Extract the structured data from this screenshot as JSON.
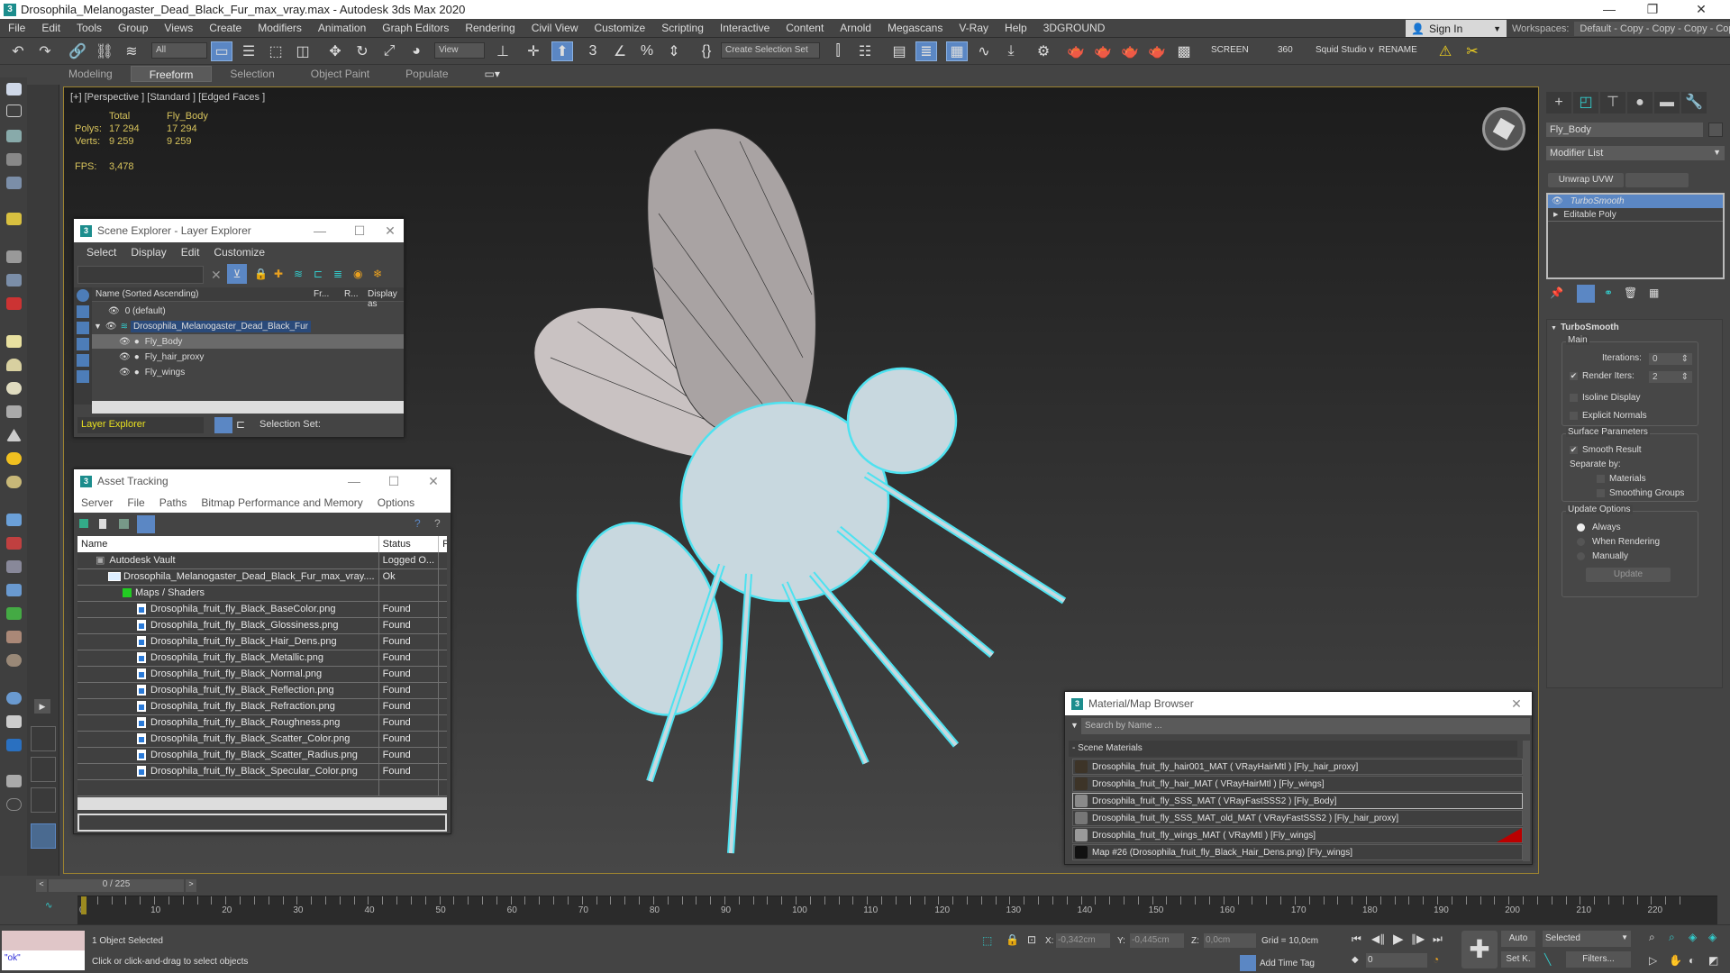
{
  "window": {
    "title": "Drosophila_Melanogaster_Dead_Black_Fur_max_vray.max - Autodesk 3ds Max 2020",
    "minimize": "—",
    "maximize": "❐",
    "close": "✕"
  },
  "menu": [
    "File",
    "Edit",
    "Tools",
    "Group",
    "Views",
    "Create",
    "Modifiers",
    "Animation",
    "Graph Editors",
    "Rendering",
    "Civil View",
    "Customize",
    "Scripting",
    "Interactive",
    "Content",
    "Arnold",
    "Megascans",
    "V-Ray",
    "Help",
    "3DGROUND"
  ],
  "account": {
    "sign_in": "Sign In",
    "workspaces_label": "Workspaces:",
    "workspace_value": "Default - Copy - Copy - Copy - Copy"
  },
  "toolbar": {
    "selection_filter": "All",
    "ref_coord": "View",
    "named_selection": "Create Selection Set",
    "screen": "SCREEN",
    "n360": "360",
    "squid": "Squid Studio v",
    "rename": "RENAME"
  },
  "ribbon": {
    "tabs": [
      "Modeling",
      "Freeform",
      "Selection",
      "Object Paint",
      "Populate"
    ],
    "active": "Freeform"
  },
  "viewport": {
    "label": "[+] [Perspective ] [Standard ] [Edged Faces ]",
    "stats": {
      "col_total": "Total",
      "col_object": "Fly_Body",
      "polys_label": "Polys:",
      "polys_total": "17 294",
      "polys_object": "17 294",
      "verts_label": "Verts:",
      "verts_total": "9 259",
      "verts_object": "9 259",
      "fps_label": "FPS:",
      "fps": "3,478"
    }
  },
  "scene_explorer": {
    "title": "Scene Explorer - Layer Explorer",
    "menu": [
      "Select",
      "Display",
      "Edit",
      "Customize"
    ],
    "columns": {
      "name": "Name (Sorted Ascending)",
      "freeze": "Fr...",
      "render": "R...",
      "display": "Display as"
    },
    "rows": [
      {
        "name": "0 (default)",
        "level": 0
      },
      {
        "name": "Drosophila_Melanogaster_Dead_Black_Fur",
        "level": 0
      },
      {
        "name": "Fly_Body",
        "level": 1
      },
      {
        "name": "Fly_hair_proxy",
        "level": 1
      },
      {
        "name": "Fly_wings",
        "level": 1
      }
    ],
    "footer_mode": "Layer Explorer",
    "selection_set_label": "Selection Set:"
  },
  "asset_tracking": {
    "title": "Asset Tracking",
    "menu": [
      "Server",
      "File",
      "Paths",
      "Bitmap Performance and Memory",
      "Options"
    ],
    "columns": [
      "Name",
      "Status",
      "Prox"
    ],
    "rows": [
      {
        "name": "Autodesk Vault",
        "status": "Logged O...",
        "indent": 1
      },
      {
        "name": "Drosophila_Melanogaster_Dead_Black_Fur_max_vray....",
        "status": "Ok",
        "indent": 2
      },
      {
        "name": "Maps / Shaders",
        "status": "",
        "indent": 3
      },
      {
        "name": "Drosophila_fruit_fly_Black_BaseColor.png",
        "status": "Found",
        "indent": 4
      },
      {
        "name": "Drosophila_fruit_fly_Black_Glossiness.png",
        "status": "Found",
        "indent": 4
      },
      {
        "name": "Drosophila_fruit_fly_Black_Hair_Dens.png",
        "status": "Found",
        "indent": 4
      },
      {
        "name": "Drosophila_fruit_fly_Black_Metallic.png",
        "status": "Found",
        "indent": 4
      },
      {
        "name": "Drosophila_fruit_fly_Black_Normal.png",
        "status": "Found",
        "indent": 4
      },
      {
        "name": "Drosophila_fruit_fly_Black_Reflection.png",
        "status": "Found",
        "indent": 4
      },
      {
        "name": "Drosophila_fruit_fly_Black_Refraction.png",
        "status": "Found",
        "indent": 4
      },
      {
        "name": "Drosophila_fruit_fly_Black_Roughness.png",
        "status": "Found",
        "indent": 4
      },
      {
        "name": "Drosophila_fruit_fly_Black_Scatter_Color.png",
        "status": "Found",
        "indent": 4
      },
      {
        "name": "Drosophila_fruit_fly_Black_Scatter_Radius.png",
        "status": "Found",
        "indent": 4
      },
      {
        "name": "Drosophila_fruit_fly_Black_Specular_Color.png",
        "status": "Found",
        "indent": 4
      }
    ]
  },
  "material_browser": {
    "title": "Material/Map Browser",
    "search_placeholder": "Search by Name ...",
    "section": "- Scene Materials",
    "items": [
      {
        "label": "Drosophila_fruit_fly_hair001_MAT  ( VRayHairMtl )  [Fly_hair_proxy]",
        "swatch": "#3d3428"
      },
      {
        "label": "Drosophila_fruit_fly_hair_MAT  ( VRayHairMtl )  [Fly_wings]",
        "swatch": "#3d3428"
      },
      {
        "label": "Drosophila_fruit_fly_SSS_MAT  ( VRayFastSSS2 )  [Fly_Body]",
        "swatch": "#8a8a8a"
      },
      {
        "label": "Drosophila_fruit_fly_SSS_MAT_old_MAT  ( VRayFastSSS2 )  [Fly_hair_proxy]",
        "swatch": "#777777"
      },
      {
        "label": "Drosophila_fruit_fly_wings_MAT  ( VRayMtl )  [Fly_wings]",
        "swatch": "#9a9a9a"
      },
      {
        "label": "Map #26 (Drosophila_fruit_fly_Black_Hair_Dens.png)  [Fly_wings]",
        "swatch": "#111111"
      }
    ]
  },
  "command_panel": {
    "object_name": "Fly_Body",
    "modifier_list": "Modifier List",
    "unwrap_button": "Unwrap UVW",
    "stack": [
      "TurboSmooth",
      "Editable Poly"
    ],
    "rollout_title": "TurboSmooth",
    "main_group": "Main",
    "iterations_label": "Iterations:",
    "iterations": "0",
    "render_iters_label": "Render Iters:",
    "render_iters": "2",
    "render_iters_checked": true,
    "isoline": "Isoline Display",
    "explicit_normals": "Explicit Normals",
    "surface_group": "Surface Parameters",
    "smooth_result": "Smooth Result",
    "separate_by": "Separate by:",
    "materials": "Materials",
    "smoothing_groups": "Smoothing Groups",
    "update_group": "Update Options",
    "opt_always": "Always",
    "opt_rendering": "When Rendering",
    "opt_manually": "Manually",
    "update_button": "Update"
  },
  "timeline": {
    "frame_display": "0 / 225",
    "ticks": [
      "0",
      "10",
      "20",
      "30",
      "40",
      "50",
      "60",
      "70",
      "80",
      "90",
      "100",
      "110",
      "120",
      "130",
      "140",
      "150",
      "160",
      "170",
      "180",
      "190",
      "200",
      "210",
      "220"
    ],
    "max_frame": 225,
    "current_frame": 0
  },
  "status": {
    "maxscript_output": "\"ok\"",
    "selected": "1 Object Selected",
    "prompt": "Click or click-and-drag to select objects",
    "x_label": "X:",
    "x": "-0,342cm",
    "y_label": "Y:",
    "y": "-0,445cm",
    "z_label": "Z:",
    "z": "0,0cm",
    "grid": "Grid = 10,0cm",
    "add_time_tag": "Add Time Tag",
    "frame_field": "0",
    "auto_key": "Auto",
    "set_key": "Set K.",
    "key_filter": "Selected",
    "filters": "Filters..."
  },
  "colors": {
    "accent": "#5b87c4",
    "viewport_border": "#9c8330",
    "selection_wire": "#4ee2f0",
    "stats_text": "#d7c35c"
  }
}
